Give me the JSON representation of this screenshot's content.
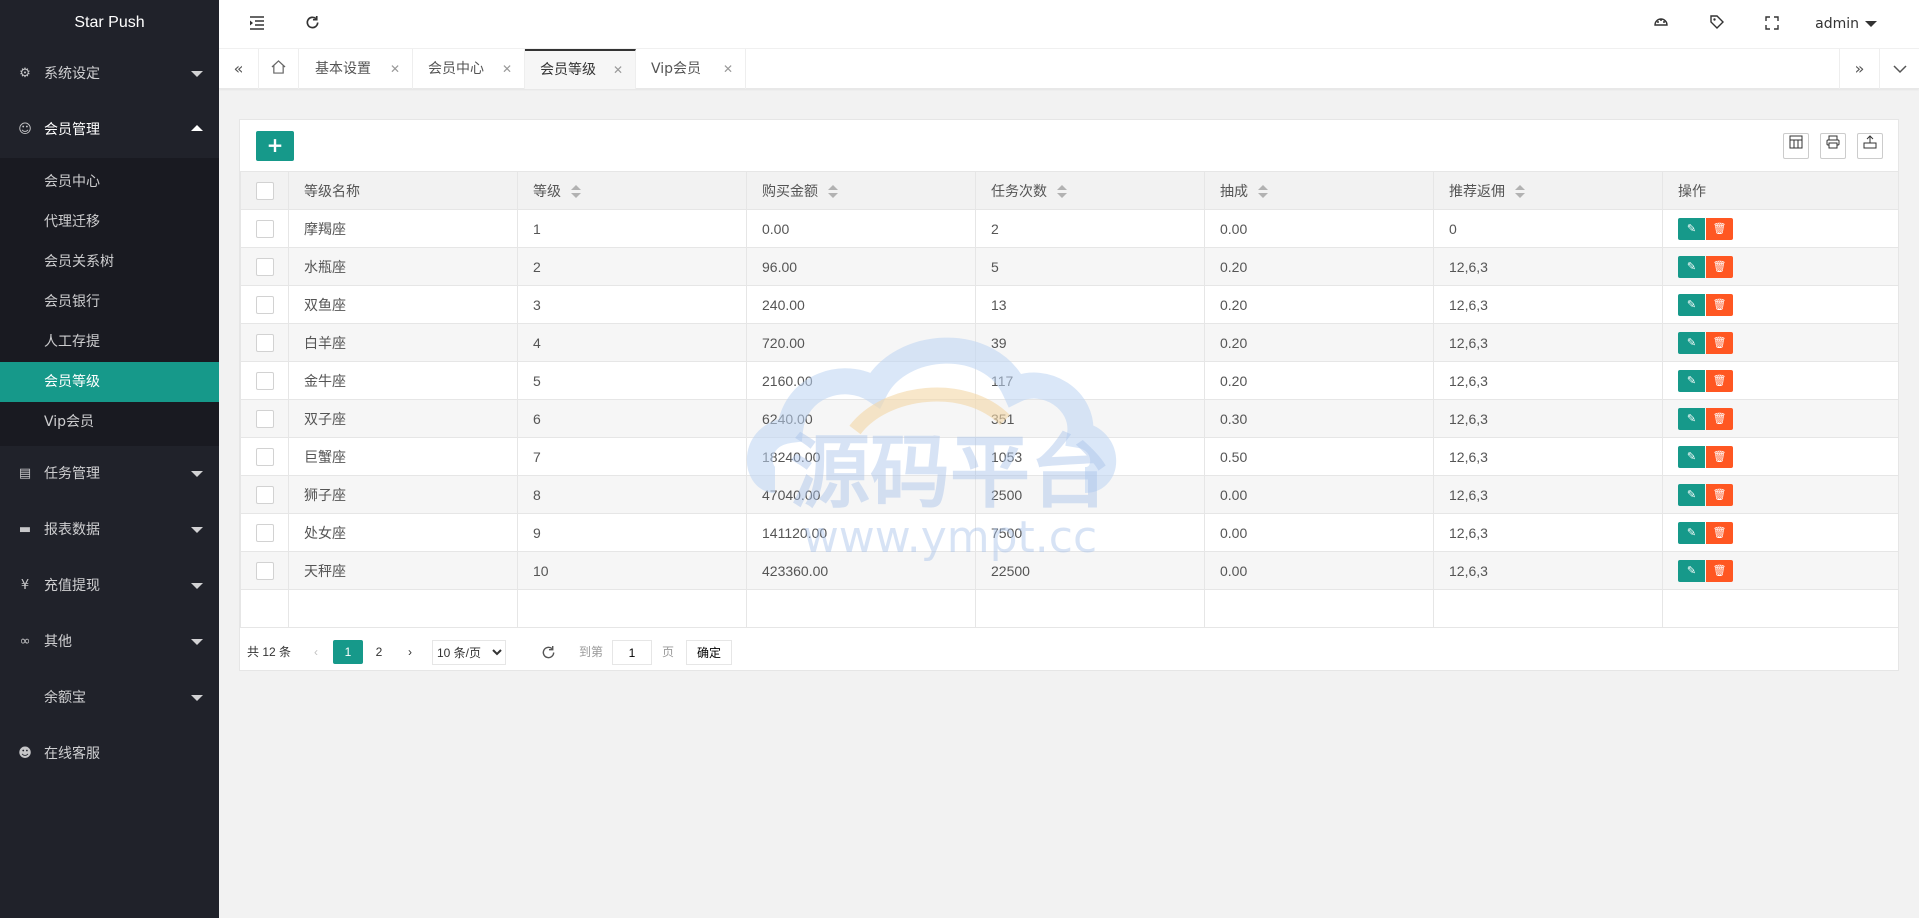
{
  "app": {
    "title": "Star Push"
  },
  "sidebar": {
    "groups": [
      {
        "label": "系统设定",
        "icon": "gear-icon"
      },
      {
        "label": "会员管理",
        "icon": "user-icon"
      },
      {
        "label": "任务管理",
        "icon": "file-icon"
      },
      {
        "label": "报表数据",
        "icon": "chat-icon"
      },
      {
        "label": "充值提现",
        "icon": "yen-icon"
      },
      {
        "label": "其他",
        "icon": "link-icon"
      },
      {
        "label": "余额宝",
        "icon": ""
      },
      {
        "label": "在线客服",
        "icon": "support-icon"
      }
    ],
    "member_sub": [
      "会员中心",
      "代理迁移",
      "会员关系树",
      "会员银行",
      "人工存提",
      "会员等级",
      "Vip会员"
    ]
  },
  "header": {
    "user": "admin"
  },
  "tabs": [
    "基本设置",
    "会员中心",
    "会员等级",
    "Vip会员"
  ],
  "table": {
    "headers": [
      "等级名称",
      "等级",
      "购买金额",
      "任务次数",
      "抽成",
      "推荐返佣",
      "操作"
    ],
    "rows": [
      [
        "摩羯座",
        "1",
        "0.00",
        "2",
        "0.00",
        "0"
      ],
      [
        "水瓶座",
        "2",
        "96.00",
        "5",
        "0.20",
        "12,6,3"
      ],
      [
        "双鱼座",
        "3",
        "240.00",
        "13",
        "0.20",
        "12,6,3"
      ],
      [
        "白羊座",
        "4",
        "720.00",
        "39",
        "0.20",
        "12,6,3"
      ],
      [
        "金牛座",
        "5",
        "2160.00",
        "117",
        "0.20",
        "12,6,3"
      ],
      [
        "双子座",
        "6",
        "6240.00",
        "351",
        "0.30",
        "12,6,3"
      ],
      [
        "巨蟹座",
        "7",
        "18240.00",
        "1053",
        "0.50",
        "12,6,3"
      ],
      [
        "狮子座",
        "8",
        "47040.00",
        "2500",
        "0.00",
        "12,6,3"
      ],
      [
        "处女座",
        "9",
        "141120.00",
        "7500",
        "0.00",
        "12,6,3"
      ],
      [
        "天秤座",
        "10",
        "423360.00",
        "22500",
        "0.00",
        "12,6,3"
      ]
    ]
  },
  "pager": {
    "total": "共 12 条",
    "pages": [
      "1",
      "2"
    ],
    "page_size": "10 条/页",
    "goto_label": "到第",
    "goto_value": "1",
    "page_unit": "页",
    "confirm": "确定"
  },
  "watermark": {
    "title": "源码平台",
    "url": "www.ympt.cc"
  },
  "colors": {
    "accent": "#16998a",
    "danger": "#ff5722",
    "sidebar": "#20222a"
  }
}
